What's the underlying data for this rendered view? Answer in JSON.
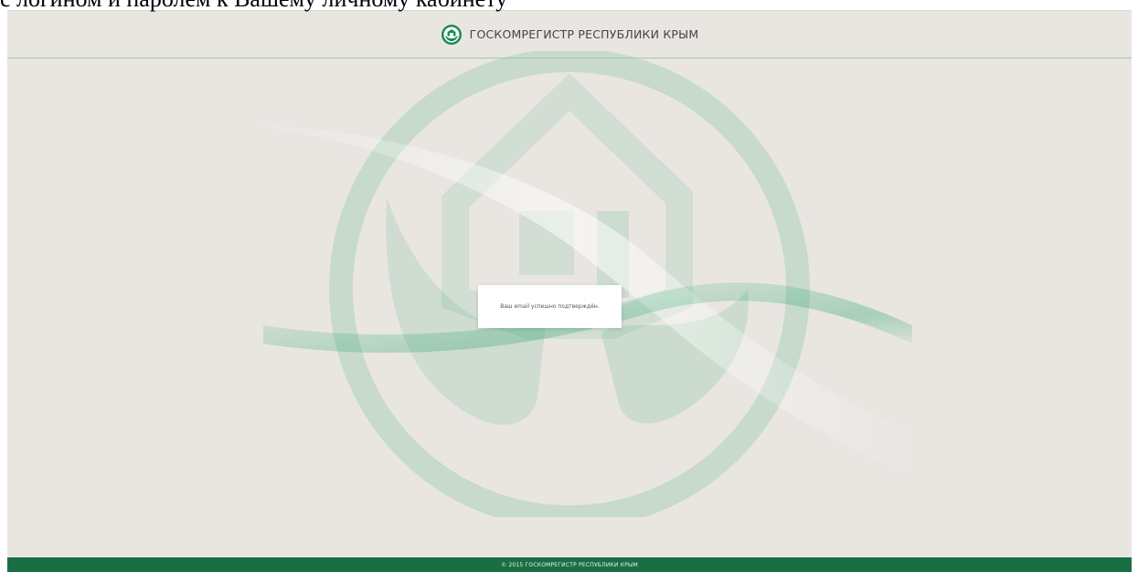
{
  "top_caption": "с логином и паролем к Вашему личному кабинету",
  "header": {
    "title": "ГОСКОМРЕГИСТР РЕСПУБЛИКИ КРЫМ",
    "logo_icon": "gosreg-logo-icon"
  },
  "notification": {
    "message": "Ваш email успешно подтверждён."
  },
  "footer": {
    "copyright": "© 2015 ГОСКОМРЕГИСТР РЕСПУБЛИКИ КРЫМ"
  },
  "colors": {
    "page_bg": "#e9e6e2",
    "brand_green": "#1a6e43",
    "emblem_green": "#2fa56b"
  }
}
